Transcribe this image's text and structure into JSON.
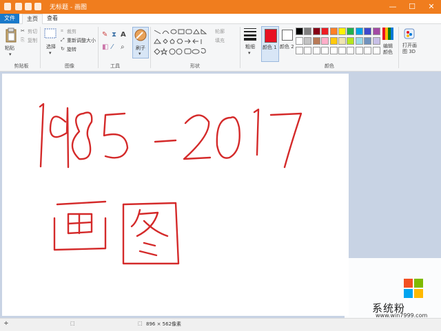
{
  "window": {
    "title": "无标题 - 画图",
    "controls": [
      "—",
      "☐",
      "✕"
    ]
  },
  "tabs": {
    "file": "文件",
    "home": "主页",
    "view": "查看"
  },
  "ribbon": {
    "clipboard": {
      "paste": "粘贴",
      "cut": "剪切",
      "copy": "复制",
      "group": "剪贴板"
    },
    "image": {
      "select": "选择",
      "crop": "裁剪",
      "resize": "重新调整大小",
      "rotate": "旋转",
      "group": "图像"
    },
    "tools": {
      "group": "工具"
    },
    "brush": {
      "label": "刷子"
    },
    "shapes": {
      "outline": "轮廓",
      "fill": "填充",
      "group": "形状"
    },
    "size": {
      "label": "粗细"
    },
    "colors": {
      "color1": "颜色 1",
      "color2": "颜色 2",
      "edit": "编辑颜色",
      "group": "颜色",
      "color1_value": "#e81123",
      "color2_value": "#ffffff",
      "palette_row1": [
        "#000000",
        "#7f7f7f",
        "#880015",
        "#ed1c24",
        "#ff7f27",
        "#fff200",
        "#22b14c",
        "#00a2e8",
        "#3f48cc",
        "#a349a4"
      ],
      "palette_row2": [
        "#ffffff",
        "#c3c3c3",
        "#b97a57",
        "#ffaec9",
        "#ffc90e",
        "#efe4b0",
        "#b5e61d",
        "#99d9ea",
        "#7092be",
        "#c8bfe7"
      ]
    },
    "paint3d": {
      "label": "打开画图 3D"
    }
  },
  "canvas": {
    "drawing_line1": "1985-2017",
    "drawing_line2": "画图",
    "ink_color": "#d42a2a"
  },
  "status": {
    "dimensions": "896 × 562像素"
  },
  "watermark": {
    "brand": "系统粉",
    "url": "www.win7999.com"
  }
}
